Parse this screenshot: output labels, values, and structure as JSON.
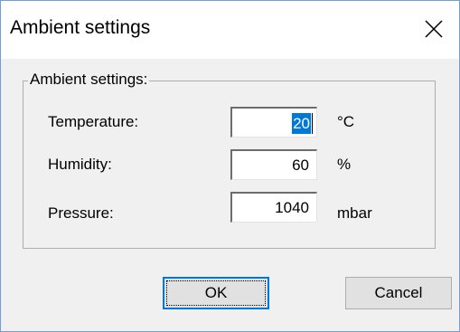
{
  "window": {
    "title": "Ambient settings",
    "close_icon": "close-icon"
  },
  "group": {
    "label": "Ambient settings:"
  },
  "fields": [
    {
      "label": "Temperature:",
      "value": "20",
      "unit": "°C",
      "selected": true
    },
    {
      "label": "Humidity:",
      "value": "60",
      "unit": "%"
    },
    {
      "label": "Pressure:",
      "value": "1040",
      "unit": "mbar"
    }
  ],
  "buttons": {
    "ok_label": "OK",
    "cancel_label": "Cancel"
  },
  "colors": {
    "accent": "#0078d7",
    "window_border": "#6f9fd8",
    "dialog_background": "#f0f0f0"
  }
}
